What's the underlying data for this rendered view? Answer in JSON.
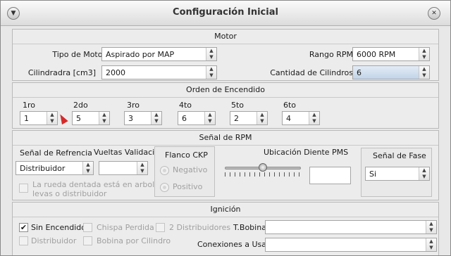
{
  "window": {
    "title": "Configuración Inicial"
  },
  "motor": {
    "title": "Motor",
    "tipo_label": "Tipo de Motor",
    "tipo_value": "Aspirado por MAP",
    "cil_label": "Cilindradra [cm3]",
    "cil_value": "2000",
    "rango_label": "Rango RPM",
    "rango_value": "6000 RPM",
    "cant_label": "Cantidad de Cilindros",
    "cant_value": "6"
  },
  "orden": {
    "title": "Orden de Encendido",
    "items": [
      {
        "label": "1ro",
        "value": "1"
      },
      {
        "label": "2do",
        "value": "5"
      },
      {
        "label": "3ro",
        "value": "3"
      },
      {
        "label": "4to",
        "value": "6"
      },
      {
        "label": "5to",
        "value": "2"
      },
      {
        "label": "6to",
        "value": "4"
      }
    ]
  },
  "rpm": {
    "title": "Señal de RPM",
    "ref_label": "Señal de Refrencia",
    "ref_value": "Distribuidor",
    "vueltas_label": "Vueltas Validación",
    "vueltas_value": "",
    "rueda_text_1": "La rueda dentada está en arbol de",
    "rueda_text_2": "levas o distribuidor",
    "flanco_title": "Flanco CKP",
    "negativo": "Negativo",
    "positivo": "Positivo",
    "ubicacion_label": "Ubicación Diente PMS",
    "ubicacion_value": "",
    "fase_title": "Señal de Fase",
    "fase_value": "Si"
  },
  "ignicion": {
    "title": "Ignición",
    "sin_encendido": "Sin Encendido",
    "chispa": "Chispa Perdida",
    "dos_dist": "2 Distribuidores",
    "distribuidor": "Distribuidor",
    "bobina": "Bobina por Cilindro",
    "tbobina_label": "T.Bobina",
    "tbobina_value": "",
    "conexiones_label": "Conexiones a Usar",
    "conexiones_value": ""
  }
}
